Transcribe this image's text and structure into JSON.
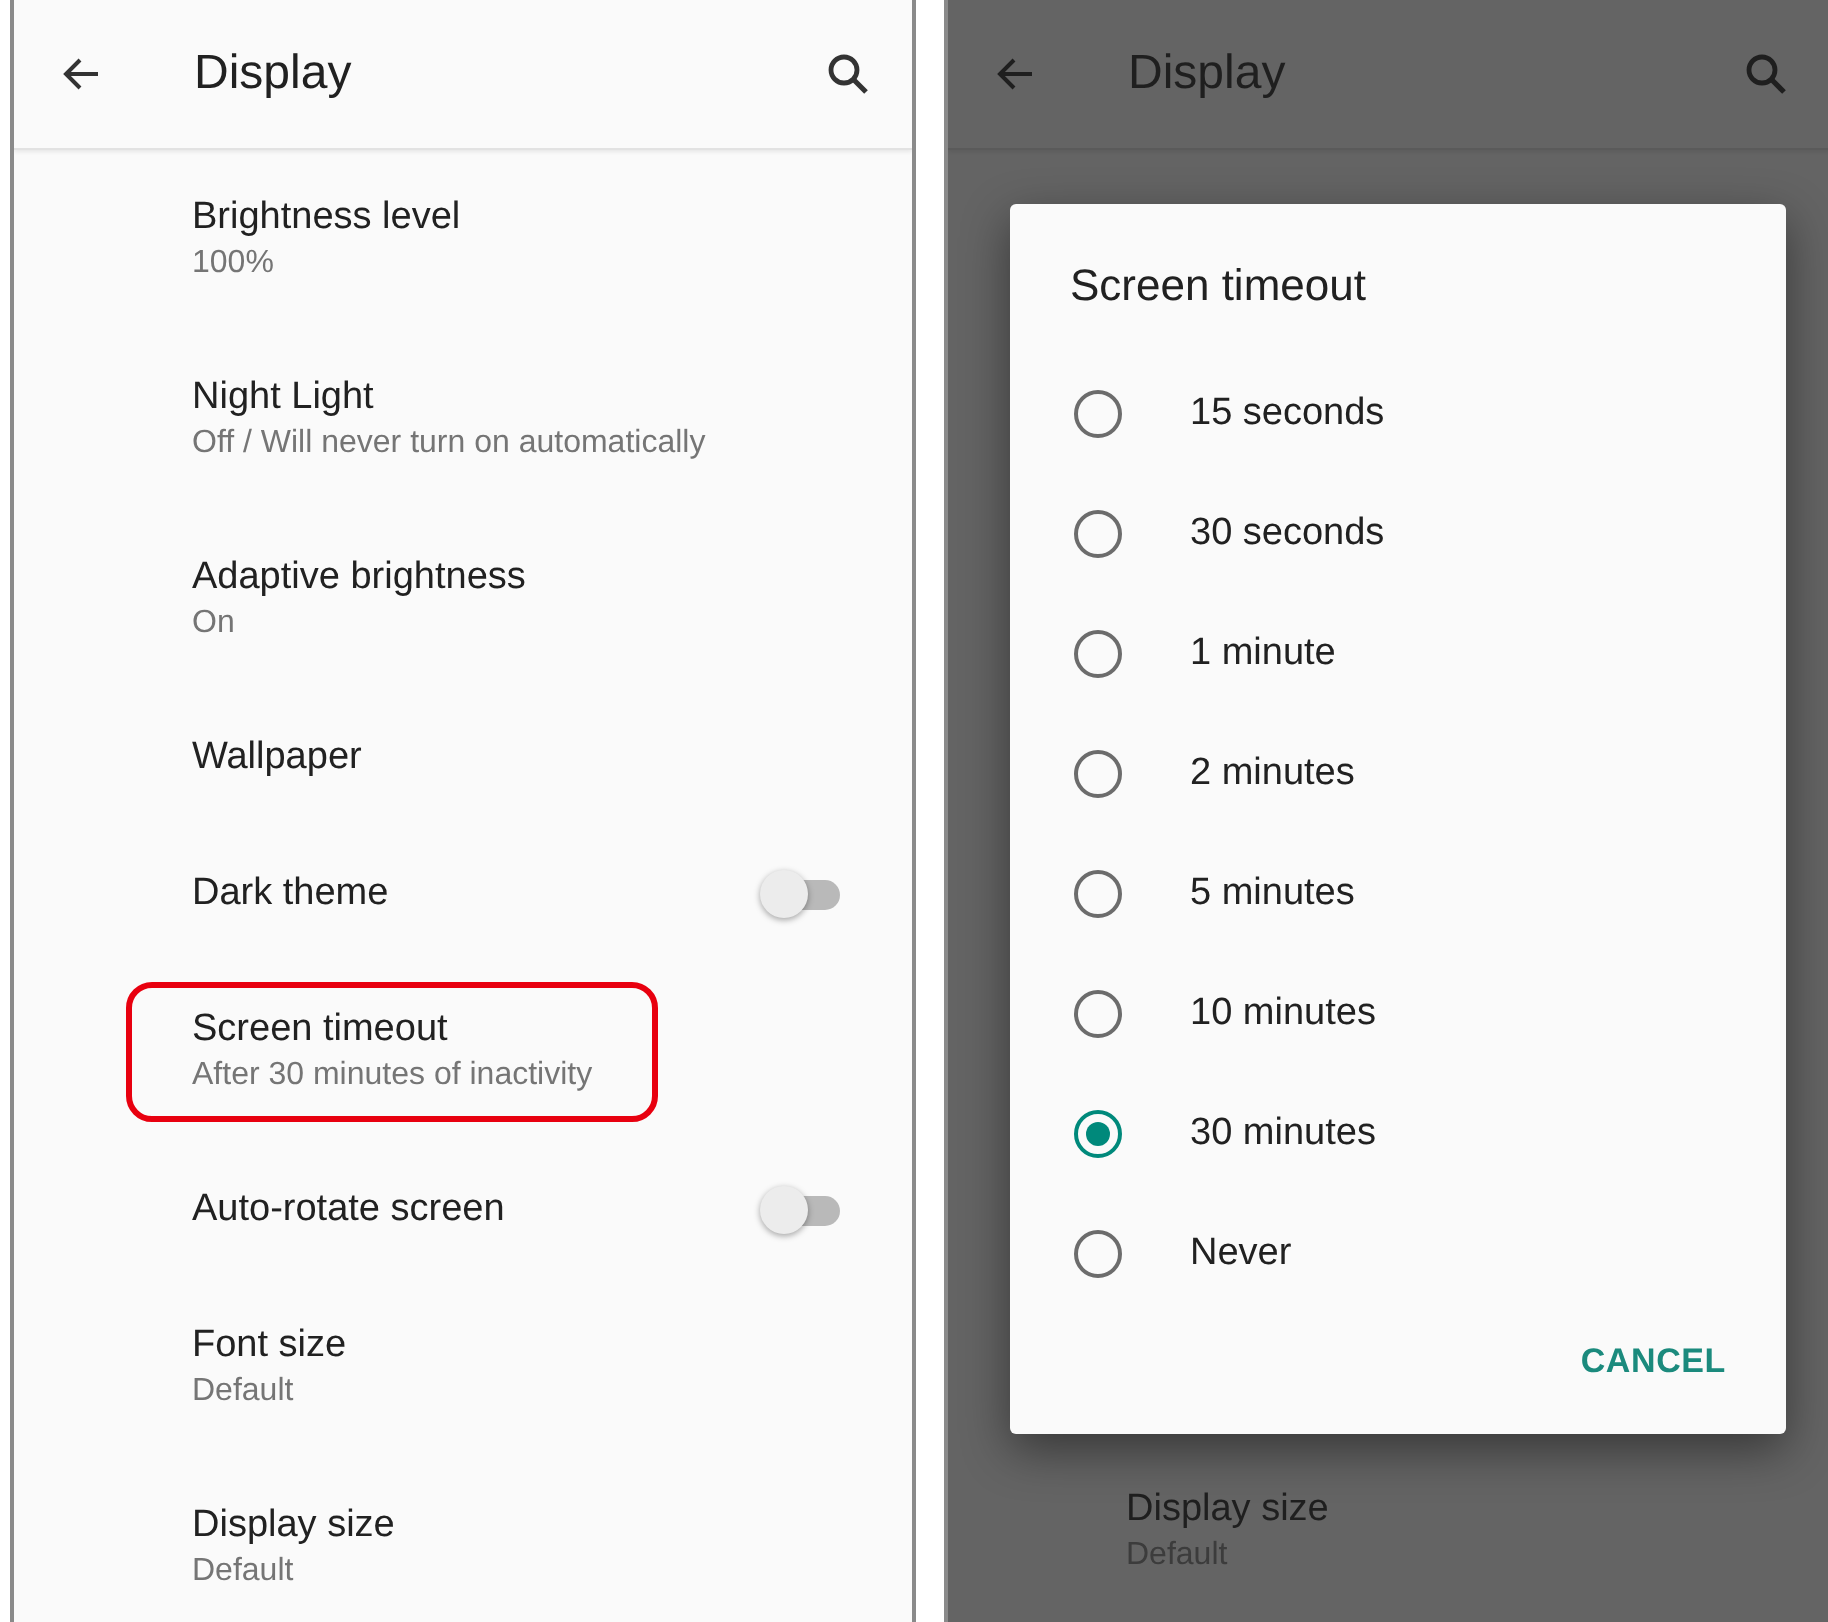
{
  "screens": [
    {
      "title": "Display",
      "dimmed": false,
      "items": [
        {
          "kind": "text",
          "title": "Brightness level",
          "subtitle": "100%",
          "highlighted": false
        },
        {
          "kind": "text",
          "title": "Night Light",
          "subtitle": "Off / Will never turn on automatically",
          "highlighted": false
        },
        {
          "kind": "text",
          "title": "Adaptive brightness",
          "subtitle": "On",
          "highlighted": false
        },
        {
          "kind": "text",
          "title": "Wallpaper",
          "highlighted": false
        },
        {
          "kind": "switch",
          "title": "Dark theme",
          "on": false,
          "highlighted": false
        },
        {
          "kind": "text",
          "title": "Screen timeout",
          "subtitle": "After 30 minutes of inactivity",
          "highlighted": true
        },
        {
          "kind": "switch",
          "title": "Auto-rotate screen",
          "on": false,
          "highlighted": false
        },
        {
          "kind": "text",
          "title": "Font size",
          "subtitle": "Default",
          "highlighted": false
        },
        {
          "kind": "text",
          "title": "Display size",
          "subtitle": "Default",
          "highlighted": false
        }
      ]
    },
    {
      "title": "Display",
      "dimmed": true,
      "items": [
        {
          "kind": "text",
          "title": "Display size",
          "subtitle": "Default",
          "highlighted": false
        }
      ],
      "dialog": {
        "title": "Screen timeout",
        "options": [
          {
            "label": "15 seconds",
            "selected": false
          },
          {
            "label": "30 seconds",
            "selected": false
          },
          {
            "label": "1 minute",
            "selected": false
          },
          {
            "label": "2 minutes",
            "selected": false
          },
          {
            "label": "5 minutes",
            "selected": false
          },
          {
            "label": "10 minutes",
            "selected": false
          },
          {
            "label": "30 minutes",
            "selected": true
          },
          {
            "label": "Never",
            "selected": false
          }
        ],
        "button": "CANCEL"
      }
    }
  ]
}
